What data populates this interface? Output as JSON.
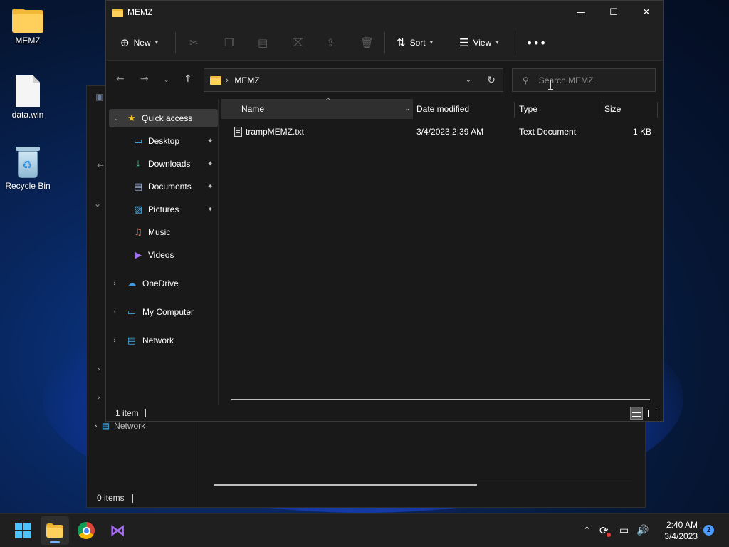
{
  "desktop": {
    "icons": [
      {
        "label": "MEMZ",
        "icon": "folder-icon"
      },
      {
        "label": "data.win",
        "icon": "file-icon"
      },
      {
        "label": "Recycle Bin",
        "icon": "recycle-bin-icon"
      }
    ]
  },
  "window": {
    "title": "MEMZ",
    "controls": [
      "minimize",
      "maximize",
      "close"
    ]
  },
  "toolbar": {
    "new_label": "New",
    "sort_label": "Sort",
    "view_label": "View",
    "disabled_icons": [
      "cut-icon",
      "copy-icon",
      "paste-icon",
      "rename-icon",
      "share-icon",
      "delete-icon"
    ]
  },
  "address": {
    "crumbs": [
      "MEMZ"
    ],
    "search_placeholder": "Search MEMZ"
  },
  "nav": {
    "quick_access": "Quick access",
    "pinned": [
      {
        "label": "Desktop",
        "pinned": true
      },
      {
        "label": "Downloads",
        "pinned": true
      },
      {
        "label": "Documents",
        "pinned": true
      },
      {
        "label": "Pictures",
        "pinned": true
      },
      {
        "label": "Music",
        "pinned": false
      },
      {
        "label": "Videos",
        "pinned": false
      }
    ],
    "roots": [
      "OneDrive",
      "My Computer",
      "Network"
    ]
  },
  "columns": {
    "name": "Name",
    "date": "Date modified",
    "type": "Type",
    "size": "Size"
  },
  "files": [
    {
      "name": "trampMEMZ.txt",
      "date": "3/4/2023 2:39 AM",
      "type": "Text Document",
      "size": "1 KB"
    }
  ],
  "status": {
    "items": "1 item"
  },
  "bg_window": {
    "network_label": "Network",
    "status": "0 items"
  },
  "taskbar": {
    "time": "2:40 AM",
    "date": "3/4/2023",
    "notifications": "2"
  },
  "colors": {
    "accent": "#4cc2ff",
    "window_bg": "#191919",
    "folder": "#ffd15c"
  }
}
